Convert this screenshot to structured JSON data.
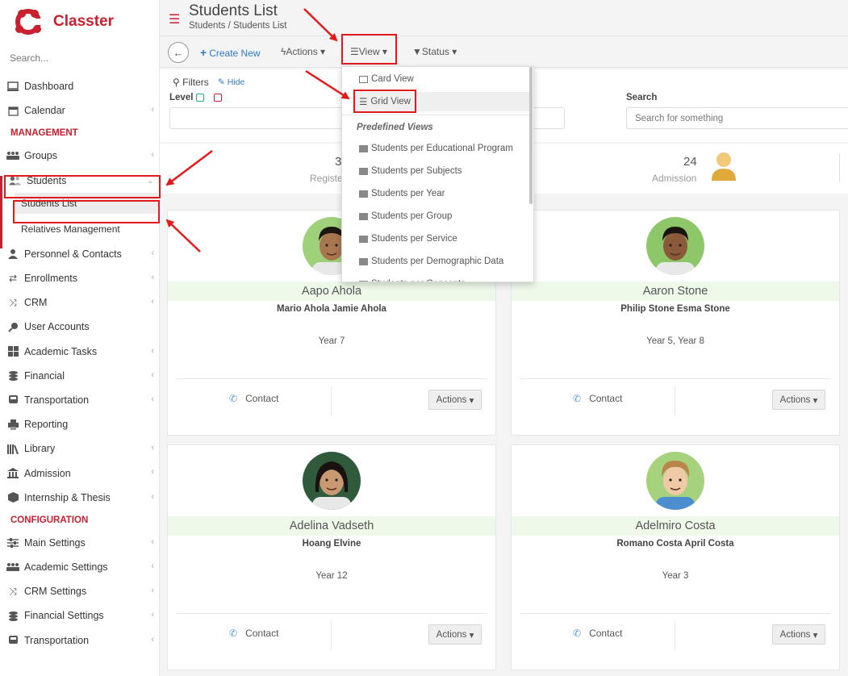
{
  "app": {
    "name": "Classter"
  },
  "sidebar": {
    "search_placeholder": "Search...",
    "top_items": [
      {
        "label": "Dashboard",
        "icon": "monitor-icon"
      },
      {
        "label": "Calendar",
        "icon": "calendar-icon"
      }
    ],
    "management_title": "MANAGEMENT",
    "groups": "Groups",
    "students": "Students",
    "students_list": "Students List",
    "relatives": "Relatives Management",
    "management_items": [
      {
        "label": "Personnel & Contacts",
        "icon": "person-icon"
      },
      {
        "label": "Enrollments",
        "icon": "arrows-icon"
      },
      {
        "label": "CRM",
        "icon": "shuffle-icon"
      },
      {
        "label": "User Accounts",
        "icon": "key-icon"
      },
      {
        "label": "Academic Tasks",
        "icon": "grid-icon"
      },
      {
        "label": "Financial",
        "icon": "coins-icon"
      },
      {
        "label": "Transportation",
        "icon": "bus-icon"
      },
      {
        "label": "Reporting",
        "icon": "printer-icon"
      },
      {
        "label": "Library",
        "icon": "books-icon"
      },
      {
        "label": "Admission",
        "icon": "institution-icon"
      },
      {
        "label": "Internship & Thesis",
        "icon": "cube-icon"
      }
    ],
    "configuration_title": "CONFIGURATION",
    "configuration_items": [
      {
        "label": "Main Settings",
        "icon": "sliders-icon"
      },
      {
        "label": "Academic Settings",
        "icon": "group-icon"
      },
      {
        "label": "CRM Settings",
        "icon": "shuffle-icon"
      },
      {
        "label": "Financial Settings",
        "icon": "coins-icon"
      },
      {
        "label": "Transportation",
        "icon": "bus-icon"
      }
    ]
  },
  "header": {
    "title": "Students List",
    "breadcrumb": "Students  /  Students List"
  },
  "toolbar": {
    "create_new": "Create New",
    "actions": "Actions",
    "view": "View",
    "status": "Status"
  },
  "filters": {
    "title": "Filters",
    "hide": "Hide",
    "level_label": "Level",
    "search_label": "Search",
    "search_placeholder": "Search for something"
  },
  "stats": {
    "registered_num": "3",
    "registered_label": "Registe",
    "admission_num": "24",
    "admission_label": "Admission"
  },
  "view_menu": {
    "card_view": "Card View",
    "grid_view": "Grid View",
    "predefined_header": "Predefined Views",
    "predefined": [
      "Students per Educational Program",
      "Students per Subjects",
      "Students per Year",
      "Students per Group",
      "Students per Service",
      "Students per Demographic Data",
      "Students per Concepts"
    ]
  },
  "students": [
    {
      "name": "Aapo Ahola",
      "relatives": "Mario Ahola Jamie Ahola",
      "year": "Year 7",
      "contact": "Contact",
      "actions": "Actions"
    },
    {
      "name": "Aaron Stone",
      "relatives": "Philip Stone Esma Stone",
      "year": "Year 5, Year 8",
      "contact": "Contact",
      "actions": "Actions"
    },
    {
      "name": "Adelina Vadseth",
      "relatives": "Hoang Elvine",
      "year": "Year 12",
      "contact": "Contact",
      "actions": "Actions"
    },
    {
      "name": "Adelmiro Costa",
      "relatives": "Romano Costa April Costa",
      "year": "Year 3",
      "contact": "Contact",
      "actions": "Actions"
    }
  ],
  "colors": {
    "brand": "#c8202f",
    "link": "#2c7ac9",
    "annotation": "#e11b1b"
  }
}
